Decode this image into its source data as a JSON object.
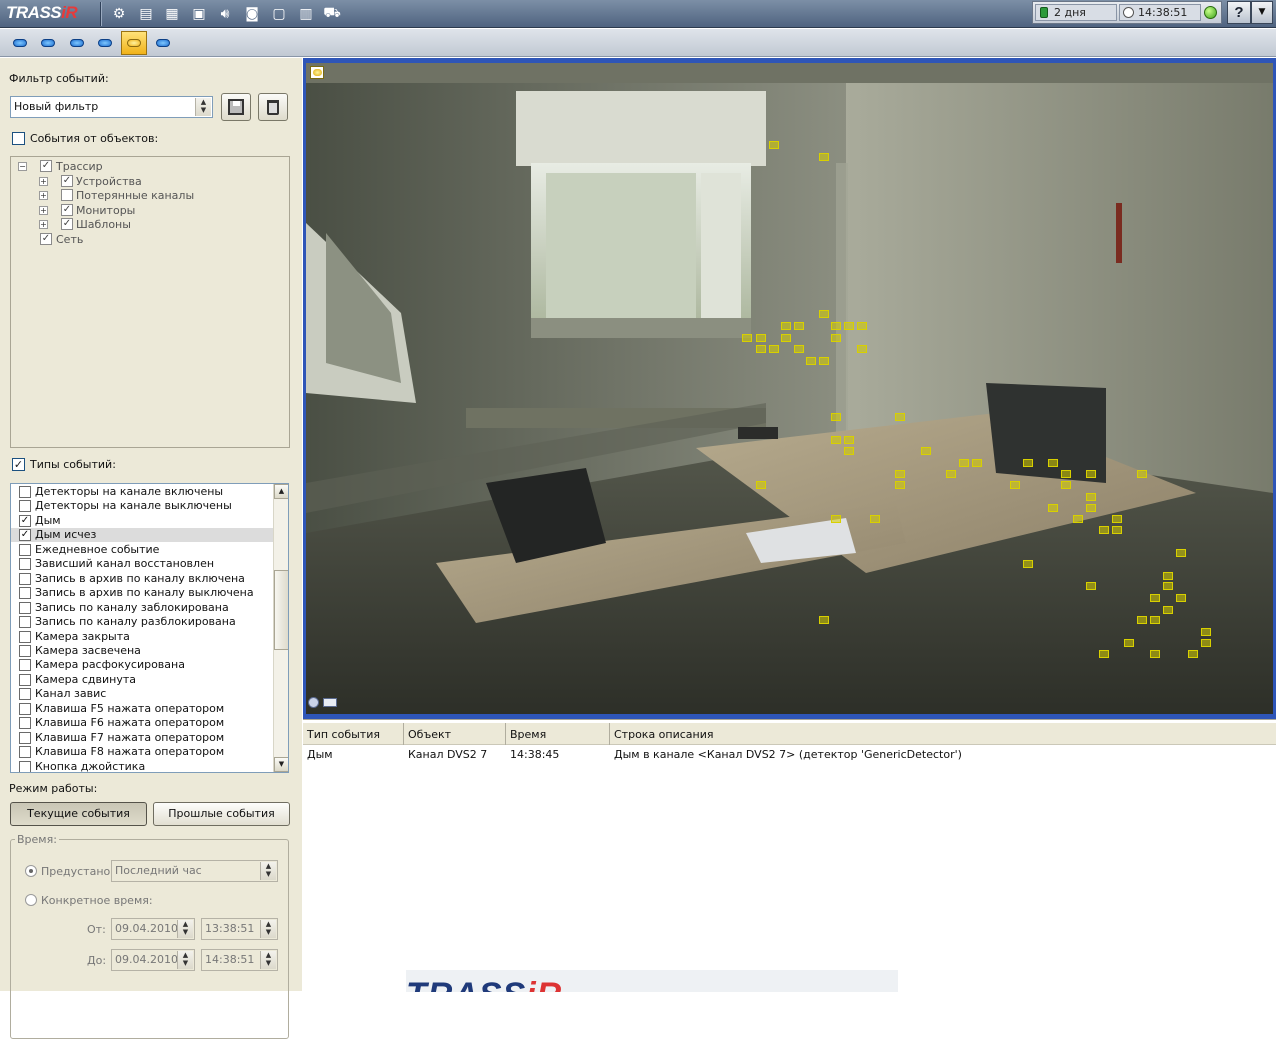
{
  "app": {
    "logo_main": "TRASS",
    "logo_accent": "iR"
  },
  "toolbar_icons": [
    "gear-icon",
    "list-view-icon",
    "grid-view-icon",
    "layout-icon",
    "speaker-icon",
    "record-icon",
    "monitor-icon",
    "template-icon",
    "bus-icon"
  ],
  "status": {
    "uptime": "2 дня",
    "clock": "14:38:51",
    "help": "?"
  },
  "layout_buttons": 6,
  "left": {
    "filter_label": "Фильтр событий:",
    "filter_value": "Новый фильтр",
    "objects_label": "События от объектов:",
    "tree": [
      {
        "label": "Трассир",
        "level": 0,
        "checked": true,
        "expand": "minus"
      },
      {
        "label": "Устройства",
        "level": 1,
        "checked": true,
        "expand": "plus"
      },
      {
        "label": "Потерянные каналы",
        "level": 1,
        "checked": false,
        "expand": "plus"
      },
      {
        "label": "Мониторы",
        "level": 1,
        "checked": true,
        "expand": "plus"
      },
      {
        "label": "Шаблоны",
        "level": 1,
        "checked": true,
        "expand": "plus"
      },
      {
        "label": "Сеть",
        "level": 0,
        "checked": true,
        "expand": "none"
      }
    ],
    "types_label": "Типы событий:",
    "event_types": [
      {
        "label": "Детекторы на канале включены",
        "checked": false,
        "selected": false
      },
      {
        "label": "Детекторы на канале выключены",
        "checked": false,
        "selected": false
      },
      {
        "label": "Дым",
        "checked": true,
        "selected": false
      },
      {
        "label": "Дым исчез",
        "checked": true,
        "selected": true
      },
      {
        "label": "Ежедневное событие",
        "checked": false,
        "selected": false
      },
      {
        "label": "Зависший канал восстановлен",
        "checked": false,
        "selected": false
      },
      {
        "label": "Запись в архив по каналу включена",
        "checked": false,
        "selected": false
      },
      {
        "label": "Запись в архив по каналу выключена",
        "checked": false,
        "selected": false
      },
      {
        "label": "Запись по каналу заблокирована",
        "checked": false,
        "selected": false
      },
      {
        "label": "Запись по каналу разблокирована",
        "checked": false,
        "selected": false
      },
      {
        "label": "Камера закрыта",
        "checked": false,
        "selected": false
      },
      {
        "label": "Камера засвечена",
        "checked": false,
        "selected": false
      },
      {
        "label": "Камера расфокусирована",
        "checked": false,
        "selected": false
      },
      {
        "label": "Камера сдвинута",
        "checked": false,
        "selected": false
      },
      {
        "label": "Канал завис",
        "checked": false,
        "selected": false
      },
      {
        "label": "Клавиша F5 нажата оператором",
        "checked": false,
        "selected": false
      },
      {
        "label": "Клавиша F6 нажата оператором",
        "checked": false,
        "selected": false
      },
      {
        "label": "Клавиша F7 нажата оператором",
        "checked": false,
        "selected": false
      },
      {
        "label": "Клавиша F8 нажата оператором",
        "checked": false,
        "selected": false
      },
      {
        "label": "Кнопка джойстика",
        "checked": false,
        "selected": false
      }
    ],
    "mode_label": "Режим работы:",
    "current_btn": "Текущие события",
    "past_btn": "Прошлые события",
    "time_label": "Время:",
    "preset_label": "Предустано",
    "preset_value": "Последний час",
    "specific_label": "Конкретное время:",
    "from_label": "От:",
    "from_date": "09.04.2010",
    "from_time": "13:38:51",
    "to_label": "До:",
    "to_date": "09.04.2010",
    "to_time": "14:38:51"
  },
  "events_table": {
    "columns": [
      "Тип события",
      "Объект",
      "Время",
      "Строка описания"
    ],
    "rows": [
      [
        "Дым",
        "Канал DVS2 7",
        "14:38:45",
        "Дым в канале <Канал DVS2 7> (детектор 'GenericDetector')"
      ]
    ]
  }
}
